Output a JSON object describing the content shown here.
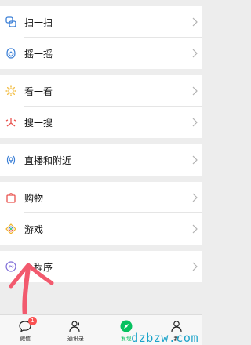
{
  "menu": {
    "group1": [
      {
        "label": "扫一扫",
        "icon": "scan-icon"
      },
      {
        "label": "摇一摇",
        "icon": "shake-icon"
      }
    ],
    "group2": [
      {
        "label": "看一看",
        "icon": "top-stories-icon"
      },
      {
        "label": "搜一搜",
        "icon": "search-icon"
      }
    ],
    "group3": [
      {
        "label": "直播和附近",
        "icon": "live-nearby-icon"
      }
    ],
    "group4": [
      {
        "label": "购物",
        "icon": "shopping-bag-icon"
      },
      {
        "label": "游戏",
        "icon": "games-icon"
      }
    ],
    "group5": [
      {
        "label": "小程序",
        "icon": "mini-programs-icon"
      }
    ]
  },
  "tabbar": {
    "tabs": [
      {
        "label": "微信",
        "icon": "chats-icon",
        "badge": "1"
      },
      {
        "label": "通讯录",
        "icon": "contacts-icon"
      },
      {
        "label": "发现",
        "icon": "discover-icon"
      },
      {
        "label": "我",
        "icon": "me-icon"
      }
    ]
  },
  "colors": {
    "accent": "#07c160",
    "badge": "#fa5151",
    "annotation_arrow": "#f25a6e",
    "watermark": "#1aa3c9"
  },
  "watermark": "dzbzw.com"
}
